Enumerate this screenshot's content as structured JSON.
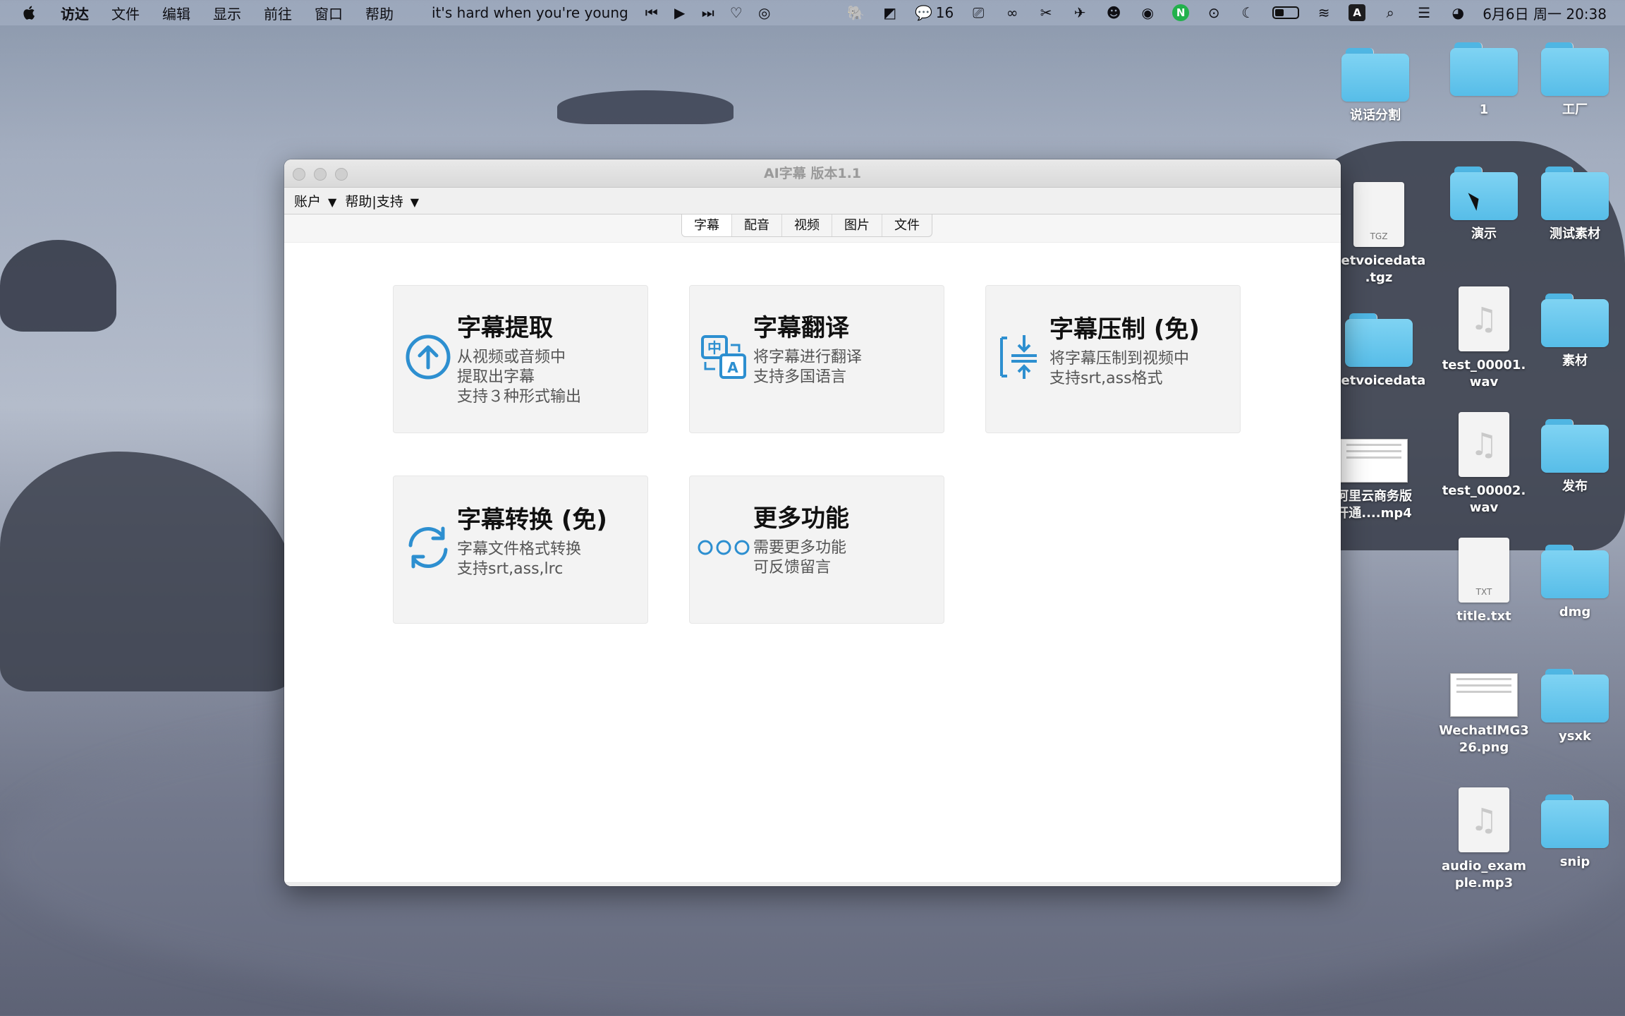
{
  "menubar": {
    "app_name": "访达",
    "menus": [
      "文件",
      "编辑",
      "显示",
      "前往",
      "窗口",
      "帮助"
    ],
    "now_playing": "it's hard when you're young",
    "chat_count": "16",
    "datetime": "6月6日 周一 20:38",
    "badge_n": "N",
    "badge_a": "A"
  },
  "window": {
    "title": "AI字幕  版本1.1",
    "menu": [
      {
        "label": "账户",
        "arrow": "▼"
      },
      {
        "label": "帮助|支持",
        "arrow": "▼"
      }
    ],
    "tabs": [
      "字幕",
      "配音",
      "视频",
      "图片",
      "文件"
    ],
    "active_tab": "字幕",
    "cards": [
      {
        "title": "字幕提取",
        "icon": "upload-circle-icon",
        "lines": [
          "从视频或音频中",
          "提取出字幕",
          "支持３种形式输出"
        ]
      },
      {
        "title": "字幕翻译",
        "icon": "translate-icon",
        "lines": [
          "将字幕进行翻译",
          "支持多国语言"
        ]
      },
      {
        "title": "字幕压制 (免)",
        "icon": "compress-icon",
        "lines": [
          "将字幕压制到视频中",
          "支持srt,ass格式"
        ]
      },
      {
        "title": "字幕转换 (免)",
        "icon": "convert-icon",
        "lines": [
          "字幕文件格式转换",
          "支持srt,ass,lrc"
        ]
      },
      {
        "title": "更多功能",
        "icon": "more-icon",
        "lines": [
          "需要更多功能",
          "可反馈留言"
        ]
      }
    ],
    "accent_color": "#2d8fd0"
  },
  "desktop": {
    "icons": [
      {
        "label": "说话分割",
        "kind": "folder"
      },
      {
        "label": "1",
        "kind": "folder"
      },
      {
        "label": "工厂",
        "kind": "folder"
      },
      {
        "label": "getvoicedata\n.tgz",
        "kind": "doc",
        "ext": "TGZ"
      },
      {
        "label": "演示",
        "kind": "folder"
      },
      {
        "label": "测试素材",
        "kind": "folder"
      },
      {
        "label": "getvoicedata",
        "kind": "folder"
      },
      {
        "label": "test_00001.\nwav",
        "kind": "audio"
      },
      {
        "label": "素材",
        "kind": "folder"
      },
      {
        "label": "阿里云商务版\n开通....mp4",
        "kind": "video"
      },
      {
        "label": "test_00002.\nwav",
        "kind": "audio"
      },
      {
        "label": "发布",
        "kind": "folder"
      },
      {
        "label": "title.txt",
        "kind": "doc",
        "ext": "TXT"
      },
      {
        "label": "dmg",
        "kind": "folder"
      },
      {
        "label": "WechatIMG3\n26.png",
        "kind": "image"
      },
      {
        "label": "ysxk",
        "kind": "folder"
      },
      {
        "label": "audio_exam\nple.mp3",
        "kind": "audio"
      },
      {
        "label": "snip",
        "kind": "folder"
      }
    ]
  }
}
